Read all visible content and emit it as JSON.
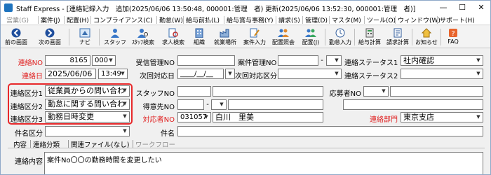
{
  "title": {
    "app": "Staff Express",
    "text": "Staff Express - [連絡記録入力　追加(2025/06/06 13:50:48, 000001:管理　者) 更新(2025/06/06 13:52:30, 000001:管理　者)]",
    "min": "—",
    "max": "☐",
    "close": "✕"
  },
  "menu": [
    {
      "label": "営業(G)",
      "disabled": true
    },
    {
      "label": "案件(J)",
      "disabled": false
    },
    {
      "label": "配置(H)",
      "disabled": false
    },
    {
      "label": "コンプライアンス(C)",
      "disabled": false
    },
    {
      "label": "勤怠(W)",
      "disabled": false
    },
    {
      "label": "給与前払(L)",
      "disabled": false
    },
    {
      "label": "給与賞与事務(Y)",
      "disabled": false
    },
    {
      "label": "請求(S)",
      "disabled": false
    },
    {
      "label": "管理(D)",
      "disabled": false
    },
    {
      "label": "マスタ(M)",
      "disabled": false
    },
    {
      "label": "ツール(O)",
      "disabled": false
    },
    {
      "label": "ウィンドウ(W)",
      "disabled": false
    },
    {
      "label": "サポート(H)",
      "disabled": false
    }
  ],
  "toolbar": {
    "prev": "前の画面",
    "next": "次の画面",
    "navi": "ナビ",
    "staff": "スタッフ",
    "staff_search": "ｽﾀｯﾌ検索",
    "case_search": "求人検索",
    "client": "組織",
    "workplace": "就業場所",
    "case_input": "案件入力",
    "assign_confirm": "配置照会",
    "assign_jp": "配置(J)",
    "attendance": "勤怠入力",
    "payroll": "給与計算",
    "billing": "請求計算",
    "notice": "お知らせ",
    "faq": "FAQ"
  },
  "form": {
    "contact_no_label": "連絡NO",
    "contact_no": "8165",
    "contact_no_suffix": "000",
    "reception_no_label": "受信管理NO",
    "case_mgmt_no_label": "案件管理NO",
    "case_mgmt_no_dash": "-",
    "status1_label": "連絡ステータス1",
    "status1_value": "社内確認",
    "contact_date_label": "連絡日",
    "contact_date": "2025/06/06",
    "contact_time": "13:49",
    "next_date_label": "次回対応日",
    "next_date_value": "____/__/__",
    "next_type_label": "次回対応区分",
    "status2_label": "連絡ステータス2",
    "cat1_label": "連絡区分1",
    "cat1_value": "従業員からの問い合わ",
    "staff_no_label": "スタッフNO",
    "applicant_no_label": "応募者NO",
    "cat2_label": "連絡区分2",
    "cat2_value": "勤怠に関する問い合わ",
    "client_no_label": "得意先NO",
    "client_no_dash": "-",
    "cat3_label": "連絡区分3",
    "cat3_value": "勤務日時変更",
    "responder_no_label": "対応者NO",
    "responder_no": "031057",
    "responder_name": "白川　里美",
    "dept_label": "連絡部門",
    "dept_value": "東京支店",
    "subject_cat_label": "件名区分",
    "subject_label": "件名",
    "content_label": "連絡内容",
    "content_value": "案件No〇〇の勤務時間を変更したい"
  },
  "tabs": [
    {
      "label": "内容",
      "disabled": false
    },
    {
      "label": "連絡分類",
      "disabled": false
    },
    {
      "label": "関連ファイル(なし)",
      "disabled": false
    },
    {
      "label": "ワークフロー",
      "disabled": true
    }
  ],
  "colors": {
    "required_label": "#e02020",
    "highlight_border": "#e8282a"
  }
}
